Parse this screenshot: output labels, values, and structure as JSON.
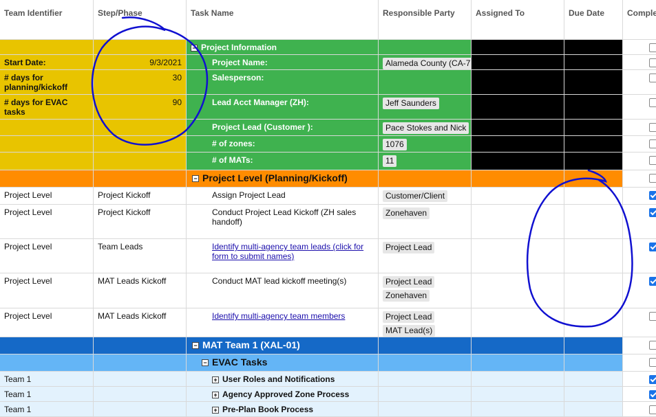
{
  "columns": [
    "Team Identifier",
    "Step/Phase",
    "Task Name",
    "Responsible Party",
    "Assigned To",
    "Due Date",
    "Complete"
  ],
  "info": {
    "start_label": "Start Date:",
    "start_value": "9/3/2021",
    "planning_label": "# days for planning/kickoff",
    "planning_value": "30",
    "evac_label": "# days for EVAC tasks",
    "evac_value": "90",
    "section_title": "Project Information",
    "project_name_label": "Project Name:",
    "project_name_value": "Alameda County (CA-7",
    "salesperson_label": "Salesperson:",
    "lead_acct_label": "Lead Acct Manager (ZH):",
    "lead_acct_value": "Jeff Saunders",
    "project_lead_label": "Project Lead (Customer ):",
    "project_lead_value": "Pace Stokes and Nick",
    "zones_label": "# of zones:",
    "zones_value": "1076",
    "mats_label": "# of MATs:",
    "mats_value": "11"
  },
  "project_level_header": "Project Level (Planning/Kickoff)",
  "tasks": [
    {
      "team": "Project Level",
      "step": "Project Kickoff",
      "task": "Assign Project Lead",
      "parties": [
        "Customer/Client"
      ],
      "complete": true
    },
    {
      "team": "Project Level",
      "step": "Project Kickoff",
      "task": "Conduct Project Lead Kickoff (ZH sales handoff)",
      "parties": [
        "Zonehaven"
      ],
      "complete": true
    },
    {
      "team": "Project Level",
      "step": "Team Leads",
      "task": "Identify multi-agency team leads (click for form to submit names)",
      "parties": [
        "Project Lead"
      ],
      "complete": true
    },
    {
      "team": "Project Level",
      "step": "MAT Leads Kickoff",
      "task": "Conduct MAT lead kickoff meeting(s)",
      "parties": [
        "Project Lead",
        "Zonehaven"
      ],
      "complete": true
    },
    {
      "team": "Project Level",
      "step": "MAT Leads Kickoff",
      "task": "Identify multi-agency team members",
      "parties": [
        "Project Lead",
        "MAT Lead(s)"
      ],
      "complete": false
    }
  ],
  "mat_header": "MAT Team 1 (XAL-01)",
  "evac_header": "EVAC Tasks",
  "subtasks": [
    {
      "team": "Team 1",
      "task": "User Roles and Notifications",
      "complete": true
    },
    {
      "team": "Team 1",
      "task": "Agency Approved Zone Process",
      "complete": true
    },
    {
      "team": "Team 1",
      "task": "Pre-Plan Book Process",
      "complete": false
    }
  ],
  "toggles": {
    "minus": "−",
    "plus": "+"
  },
  "colors": {
    "yellow": "#e8c400",
    "green": "#3fb24f",
    "orange": "#ff8c00",
    "blue": "#1569c7",
    "light_blue": "#64b5f6",
    "annotation": "#1010d0"
  }
}
